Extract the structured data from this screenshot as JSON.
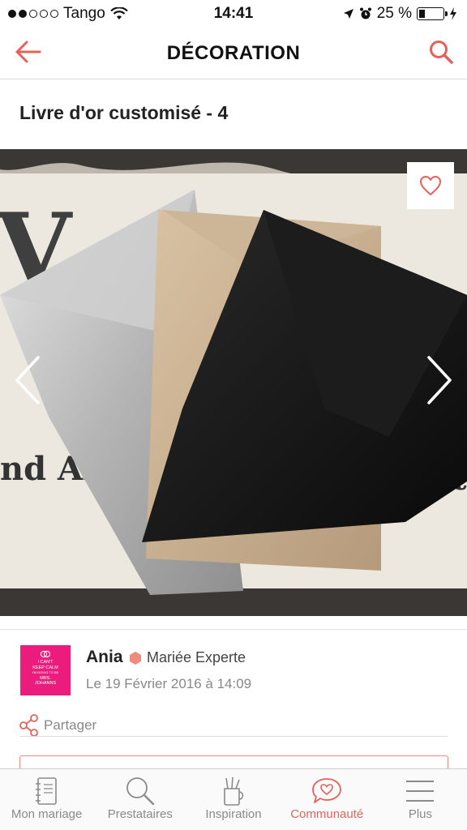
{
  "status_bar": {
    "carrier": "Tango",
    "time": "14:41",
    "battery_percent": "25 %",
    "battery_level": 0.25
  },
  "nav": {
    "title": "DÉCORATION",
    "back_icon": "arrow-left-icon",
    "search_icon": "search-icon"
  },
  "page": {
    "title": "Livre d'or customisé - 4"
  },
  "photo": {
    "favorite_icon": "heart-icon",
    "prev_icon": "chevron-left-icon",
    "next_icon": "chevron-right-icon",
    "background_text": [
      "V",
      "nd All",
      "uests"
    ]
  },
  "author": {
    "name": "Ania",
    "badge": "Mariée Experte",
    "date": "Le 19 Février 2016 à 14:09",
    "avatar_text": [
      "I CAN'T",
      "KEEP CALM",
      "I'M GOING TO BE",
      "MRS.",
      "JOHANNS"
    ]
  },
  "share": {
    "label": "Partager"
  },
  "tabs": [
    {
      "label": "Mon mariage",
      "icon": "notebook-icon",
      "active": false
    },
    {
      "label": "Prestataires",
      "icon": "magnifier-icon",
      "active": false
    },
    {
      "label": "Inspiration",
      "icon": "pencil-cup-icon",
      "active": false
    },
    {
      "label": "Communauté",
      "icon": "chat-heart-icon",
      "active": true
    },
    {
      "label": "Plus",
      "icon": "menu-icon",
      "active": false
    }
  ],
  "colors": {
    "accent": "#e8605a",
    "avatar_bg": "#ec1b7e",
    "badge_hex": "#f08a7a"
  }
}
